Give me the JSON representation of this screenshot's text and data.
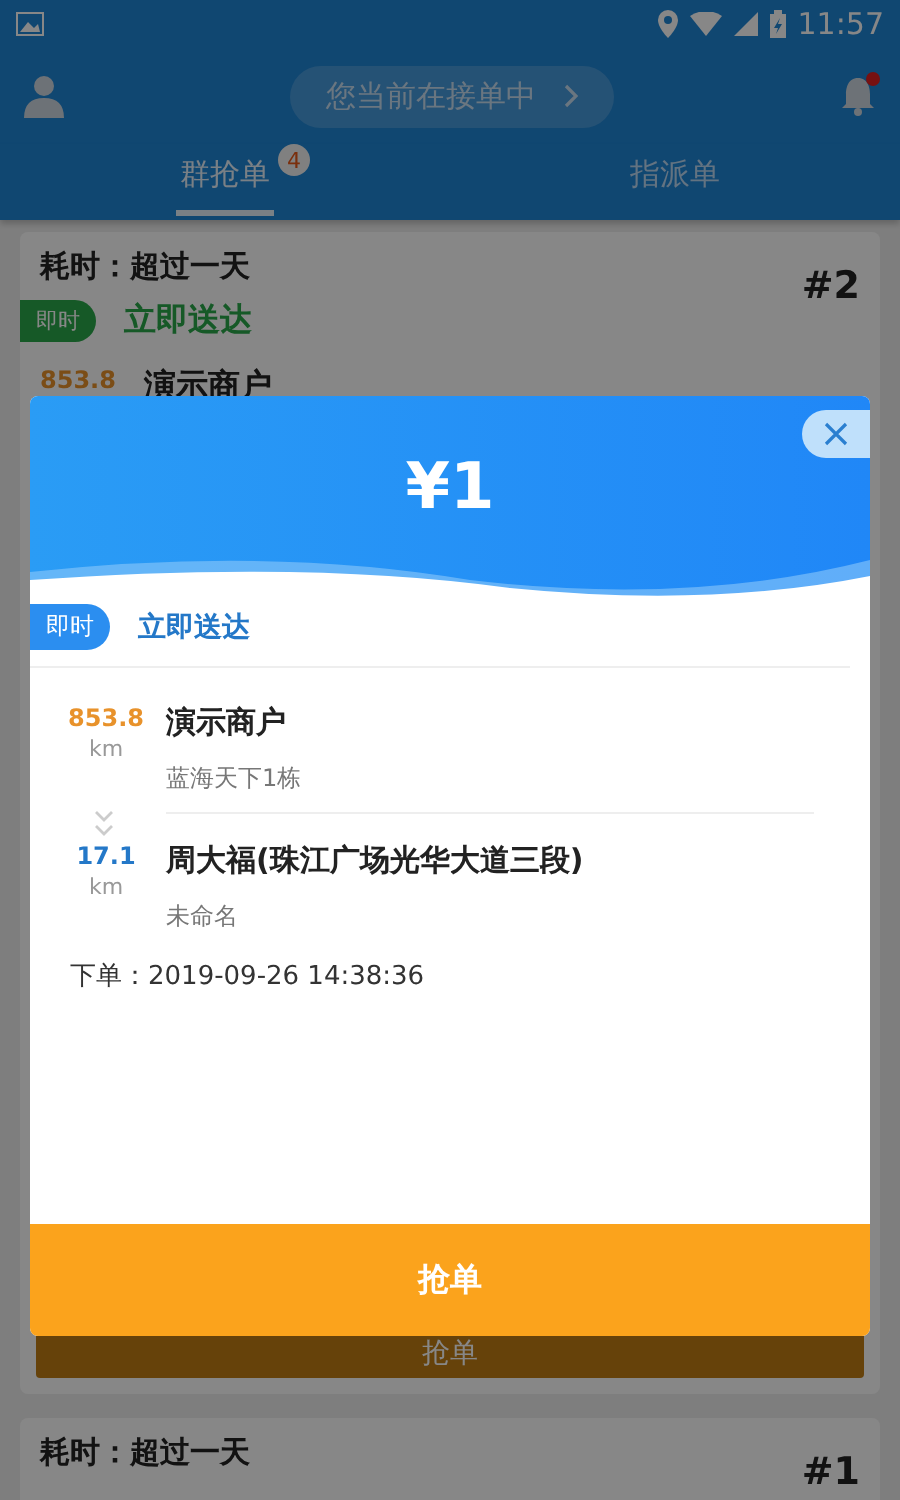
{
  "status_bar": {
    "time": "11:57"
  },
  "header": {
    "status_pill": "您当前在接单中",
    "has_unread": true
  },
  "tabs": [
    {
      "label": "群抢单",
      "selected": true,
      "badge": "4"
    },
    {
      "label": "指派单",
      "selected": false
    }
  ],
  "orders": [
    {
      "elapsed": "耗时：超过一天",
      "number": "#2",
      "tag": "即时",
      "delivery": "立即送达",
      "distance": "853.8",
      "merchant": "演示商户",
      "button": "抢单"
    },
    {
      "elapsed": "耗时：超过一天",
      "number": "#1"
    }
  ],
  "dialog": {
    "price": "¥1",
    "tag": "即时",
    "delivery": "立即送达",
    "stops": [
      {
        "kind": "pickup",
        "distance": "853.8",
        "unit": "km",
        "name": "演示商户",
        "address": "蓝海天下1栋"
      },
      {
        "kind": "dropoff",
        "distance": "17.1",
        "unit": "km",
        "name": "周大福(珠江广场光华大道三段)",
        "address": "未命名"
      }
    ],
    "order_time": "下单：2019-09-26 14:38:36",
    "button": "抢单"
  }
}
